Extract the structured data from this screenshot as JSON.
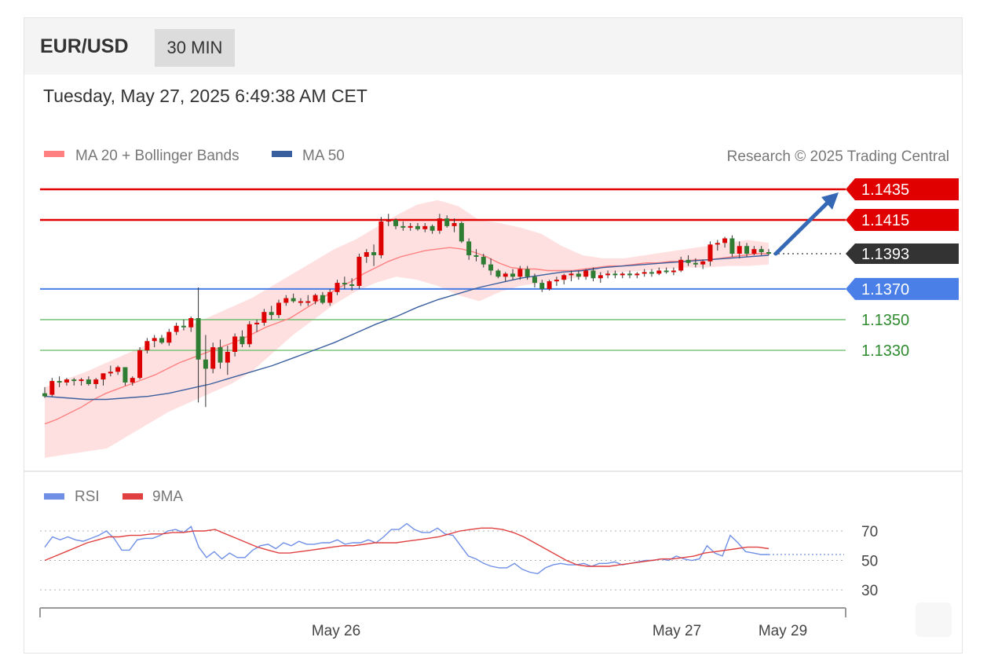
{
  "header": {
    "symbol": "EUR/USD",
    "timeframe": "30 MIN"
  },
  "timestamp": "Tuesday, May 27, 2025 6:49:38 AM CET",
  "legend": {
    "ma20_bb": "MA 20 + Bollinger Bands",
    "ma50": "MA 50"
  },
  "copyright": "Research © 2025 Trading Central",
  "rsi_legend": {
    "rsi": "RSI",
    "ma9": "9MA"
  },
  "colors": {
    "up": "#dd0000",
    "down": "#2e7d32",
    "ma20": "#ff8080",
    "ma50": "#3a5f9e",
    "bands": "#ffd6d6",
    "rsi": "#6f8fe6",
    "rsi_ma": "#e04040",
    "resistance": "#e00000",
    "support": "#4a7fe8",
    "support2": "#66bb66",
    "last": "#333333",
    "target_arrow": "#3568b5"
  },
  "chart_data": [
    {
      "type": "candlestick",
      "title": "EUR/USD",
      "timeframe": "30 MIN",
      "ylim": [
        1.1268,
        1.1448
      ],
      "x_ticks": [
        "May 26",
        "May 27",
        "May 29"
      ],
      "ohlc": [
        [
          1.1302,
          1.1306,
          1.1299,
          1.13
        ],
        [
          1.1301,
          1.1312,
          1.13,
          1.131
        ],
        [
          1.131,
          1.1313,
          1.1306,
          1.1309
        ],
        [
          1.1309,
          1.1312,
          1.1307,
          1.1311
        ],
        [
          1.1311,
          1.1312,
          1.1307,
          1.131
        ],
        [
          1.131,
          1.1312,
          1.1307,
          1.1311
        ],
        [
          1.1311,
          1.1313,
          1.1307,
          1.1308
        ],
        [
          1.1308,
          1.1312,
          1.1305,
          1.1311
        ],
        [
          1.1311,
          1.1315,
          1.1307,
          1.1315
        ],
        [
          1.1315,
          1.132,
          1.1313,
          1.1316
        ],
        [
          1.1316,
          1.132,
          1.1314,
          1.1319
        ],
        [
          1.1319,
          1.1319,
          1.1307,
          1.1309
        ],
        [
          1.1309,
          1.1313,
          1.1307,
          1.1312
        ],
        [
          1.1312,
          1.1332,
          1.1311,
          1.133
        ],
        [
          1.133,
          1.1338,
          1.1328,
          1.1336
        ],
        [
          1.1336,
          1.134,
          1.1332,
          1.1338
        ],
        [
          1.1338,
          1.134,
          1.1334,
          1.1335
        ],
        [
          1.1335,
          1.1344,
          1.1333,
          1.1342
        ],
        [
          1.1342,
          1.1348,
          1.134,
          1.1346
        ],
        [
          1.1346,
          1.135,
          1.1343,
          1.1345
        ],
        [
          1.1345,
          1.1352,
          1.1342,
          1.1351
        ],
        [
          1.1351,
          1.1371,
          1.1296,
          1.1324
        ],
        [
          1.1324,
          1.134,
          1.1293,
          1.1318
        ],
        [
          1.1318,
          1.1335,
          1.1315,
          1.1332
        ],
        [
          1.1332,
          1.1337,
          1.1318,
          1.1322
        ],
        [
          1.1322,
          1.1333,
          1.1314,
          1.1329
        ],
        [
          1.1329,
          1.1341,
          1.1326,
          1.1339
        ],
        [
          1.1339,
          1.1343,
          1.1332,
          1.1334
        ],
        [
          1.1334,
          1.1349,
          1.1332,
          1.1347
        ],
        [
          1.1347,
          1.135,
          1.1342,
          1.1348
        ],
        [
          1.1348,
          1.1357,
          1.1346,
          1.1355
        ],
        [
          1.1355,
          1.1359,
          1.135,
          1.1353
        ],
        [
          1.1353,
          1.1363,
          1.1351,
          1.1361
        ],
        [
          1.1361,
          1.1366,
          1.1359,
          1.1364
        ],
        [
          1.1364,
          1.1367,
          1.1361,
          1.1362
        ],
        [
          1.1362,
          1.1364,
          1.1359,
          1.1362
        ],
        [
          1.1362,
          1.1366,
          1.1359,
          1.1362
        ],
        [
          1.1362,
          1.1367,
          1.136,
          1.1366
        ],
        [
          1.1366,
          1.1368,
          1.136,
          1.1361
        ],
        [
          1.1361,
          1.137,
          1.1359,
          1.1368
        ],
        [
          1.1368,
          1.1376,
          1.1366,
          1.1374
        ],
        [
          1.1374,
          1.1378,
          1.137,
          1.1373
        ],
        [
          1.1373,
          1.1377,
          1.1369,
          1.1372
        ],
        [
          1.1372,
          1.1393,
          1.137,
          1.1391
        ],
        [
          1.1391,
          1.1396,
          1.1387,
          1.1394
        ],
        [
          1.1394,
          1.1399,
          1.1385,
          1.1392
        ],
        [
          1.1392,
          1.1417,
          1.139,
          1.1414
        ],
        [
          1.1414,
          1.1419,
          1.1411,
          1.1415
        ],
        [
          1.1415,
          1.1416,
          1.1409,
          1.1411
        ],
        [
          1.1411,
          1.1414,
          1.1408,
          1.141
        ],
        [
          1.141,
          1.1413,
          1.1408,
          1.1411
        ],
        [
          1.1411,
          1.1413,
          1.1408,
          1.1409
        ],
        [
          1.1409,
          1.1413,
          1.1407,
          1.1411
        ],
        [
          1.1411,
          1.1412,
          1.1406,
          1.1408
        ],
        [
          1.1408,
          1.1419,
          1.1406,
          1.1416
        ],
        [
          1.1416,
          1.1418,
          1.141,
          1.1411
        ],
        [
          1.1411,
          1.1416,
          1.1407,
          1.1413
        ],
        [
          1.1413,
          1.1414,
          1.14,
          1.1401
        ],
        [
          1.1401,
          1.1403,
          1.1389,
          1.1392
        ],
        [
          1.1392,
          1.1396,
          1.1388,
          1.1391
        ],
        [
          1.1391,
          1.1393,
          1.1384,
          1.1386
        ],
        [
          1.1386,
          1.139,
          1.1379,
          1.1382
        ],
        [
          1.1382,
          1.1383,
          1.1377,
          1.1378
        ],
        [
          1.1378,
          1.1381,
          1.1375,
          1.138
        ],
        [
          1.138,
          1.1383,
          1.1376,
          1.1378
        ],
        [
          1.1378,
          1.1385,
          1.1376,
          1.1383
        ],
        [
          1.1383,
          1.1385,
          1.1376,
          1.1378
        ],
        [
          1.1378,
          1.138,
          1.1371,
          1.1374
        ],
        [
          1.1374,
          1.1376,
          1.1368,
          1.137
        ],
        [
          1.137,
          1.1376,
          1.1369,
          1.1375
        ],
        [
          1.1375,
          1.1378,
          1.1372,
          1.1376
        ],
        [
          1.1376,
          1.138,
          1.1373,
          1.1379
        ],
        [
          1.1379,
          1.1382,
          1.1375,
          1.138
        ],
        [
          1.138,
          1.1382,
          1.1376,
          1.1378
        ],
        [
          1.1378,
          1.1383,
          1.1376,
          1.1382
        ],
        [
          1.1382,
          1.1384,
          1.1375,
          1.1377
        ],
        [
          1.1377,
          1.1381,
          1.1374,
          1.1379
        ],
        [
          1.1379,
          1.1382,
          1.1377,
          1.138
        ],
        [
          1.138,
          1.1382,
          1.1377,
          1.1379
        ],
        [
          1.1379,
          1.1381,
          1.1377,
          1.138
        ],
        [
          1.138,
          1.1382,
          1.1377,
          1.1379
        ],
        [
          1.1379,
          1.1381,
          1.1377,
          1.138
        ],
        [
          1.138,
          1.1383,
          1.1378,
          1.1381
        ],
        [
          1.1381,
          1.1383,
          1.1378,
          1.138
        ],
        [
          1.138,
          1.1384,
          1.1379,
          1.1382
        ],
        [
          1.1382,
          1.1384,
          1.138,
          1.1381
        ],
        [
          1.1381,
          1.1384,
          1.1379,
          1.1382
        ],
        [
          1.1382,
          1.1391,
          1.1381,
          1.1389
        ],
        [
          1.1389,
          1.1392,
          1.1385,
          1.1387
        ],
        [
          1.1387,
          1.139,
          1.1384,
          1.1386
        ],
        [
          1.1386,
          1.1389,
          1.1383,
          1.1388
        ],
        [
          1.1388,
          1.1401,
          1.1385,
          1.1399
        ],
        [
          1.1399,
          1.1402,
          1.1395,
          1.14
        ],
        [
          1.14,
          1.1404,
          1.1397,
          1.1403
        ],
        [
          1.1403,
          1.1405,
          1.1391,
          1.1393
        ],
        [
          1.1393,
          1.1401,
          1.139,
          1.1398
        ],
        [
          1.1398,
          1.14,
          1.1391,
          1.1393
        ],
        [
          1.1393,
          1.1398,
          1.1392,
          1.1396
        ],
        [
          1.1396,
          1.1398,
          1.1392,
          1.1394
        ],
        [
          1.1394,
          1.1396,
          1.1392,
          1.1393
        ]
      ],
      "ma20": [
        1.1282,
        1.1285,
        1.1289,
        1.1293,
        1.1298,
        1.1302,
        1.1305,
        1.1308,
        1.1311,
        1.1314,
        1.1318,
        1.1322,
        1.1325,
        1.1328,
        1.1331,
        1.1334,
        1.1337,
        1.1341,
        1.1345,
        1.1348,
        1.1351,
        1.1356,
        1.1361,
        1.1366,
        1.1371,
        1.1375,
        1.138,
        1.1384,
        1.1388,
        1.1391,
        1.1393,
        1.1395,
        1.1396,
        1.1397,
        1.1396,
        1.1394,
        1.1391,
        1.1387,
        1.1384,
        1.1383,
        1.1383,
        1.1382,
        1.1382,
        1.1382,
        1.1383,
        1.1384,
        1.1385,
        1.1385,
        1.1386,
        1.1387,
        1.1387,
        1.1388,
        1.1388,
        1.1389,
        1.1389,
        1.139,
        1.1391,
        1.1392,
        1.1393,
        1.1393
      ],
      "ma50": [
        1.13,
        1.1299,
        1.1298,
        1.1298,
        1.1299,
        1.13,
        1.1302,
        1.1305,
        1.1308,
        1.1312,
        1.1316,
        1.132,
        1.1325,
        1.133,
        1.1335,
        1.1341,
        1.1347,
        1.1352,
        1.1358,
        1.1363,
        1.1367,
        1.1371,
        1.1374,
        1.1377,
        1.1379,
        1.1381,
        1.1382,
        1.1384,
        1.1385,
        1.1386,
        1.1387,
        1.1388,
        1.1389,
        1.139,
        1.1391,
        1.1392
      ],
      "bb_upper": [
        1.1306,
        1.1311,
        1.1316,
        1.1322,
        1.1328,
        1.1334,
        1.134,
        1.1346,
        1.1352,
        1.1358,
        1.1364,
        1.1372,
        1.138,
        1.1388,
        1.1396,
        1.1402,
        1.141,
        1.1418,
        1.1425,
        1.1428,
        1.1424,
        1.1415,
        1.1413,
        1.141,
        1.1406,
        1.1398,
        1.1392,
        1.139,
        1.139,
        1.1392,
        1.1394,
        1.1396,
        1.1398,
        1.14,
        1.1402,
        1.14
      ],
      "bb_lower": [
        1.126,
        1.1262,
        1.1264,
        1.1266,
        1.1274,
        1.1282,
        1.129,
        1.1296,
        1.1302,
        1.1308,
        1.1316,
        1.1328,
        1.134,
        1.135,
        1.136,
        1.1368,
        1.1374,
        1.1378,
        1.1376,
        1.1372,
        1.1366,
        1.1362,
        1.1368,
        1.1372,
        1.1374,
        1.1376,
        1.1378,
        1.138,
        1.1381,
        1.1382,
        1.1383,
        1.1384,
        1.1384,
        1.1385,
        1.1385,
        1.1386
      ],
      "levels": [
        {
          "value": "1.1435",
          "price": 1.1435,
          "role": "resistance"
        },
        {
          "value": "1.1415",
          "price": 1.1415,
          "role": "resistance"
        },
        {
          "value": "1.1393",
          "price": 1.1393,
          "role": "last"
        },
        {
          "value": "1.1370",
          "price": 1.137,
          "role": "support"
        },
        {
          "value": "1.1350",
          "price": 1.135,
          "role": "support2"
        },
        {
          "value": "1.1330",
          "price": 1.133,
          "role": "support2"
        }
      ],
      "arrow": {
        "from": 1.1393,
        "to": 1.1435
      }
    },
    {
      "type": "line",
      "title": "RSI",
      "ylim": [
        22,
        78
      ],
      "yticks": [
        "70",
        "50",
        "30"
      ],
      "series": [
        {
          "name": "RSI",
          "values": [
            59,
            66,
            64,
            66,
            64,
            63,
            65,
            67,
            70,
            65,
            57,
            57,
            64,
            65,
            65,
            67,
            70,
            71,
            69,
            73,
            59,
            52,
            56,
            51,
            55,
            52,
            52,
            57,
            60,
            61,
            58,
            62,
            60,
            63,
            61,
            61,
            62,
            62,
            64,
            61,
            62,
            62,
            64,
            62,
            66,
            71,
            71,
            75,
            71,
            69,
            69,
            72,
            68,
            67,
            60,
            53,
            51,
            48,
            46,
            45,
            45,
            48,
            44,
            42,
            41,
            45,
            47,
            48,
            47,
            47,
            48,
            46,
            48,
            48,
            49,
            47,
            48,
            49,
            50,
            50,
            51,
            50,
            53,
            51,
            50,
            51,
            60,
            55,
            53,
            67,
            62,
            56,
            55,
            54,
            54
          ]
        },
        {
          "name": "9MA",
          "values": [
            50,
            53,
            56,
            59,
            62,
            64,
            66,
            66,
            67,
            67,
            68,
            68,
            69,
            69,
            70,
            70,
            71,
            68,
            65,
            62,
            59,
            57,
            55,
            55,
            56,
            57,
            58,
            59,
            60,
            60,
            61,
            62,
            62,
            62,
            63,
            64,
            65,
            66,
            68,
            70,
            71,
            72,
            72,
            71,
            69,
            66,
            62,
            58,
            54,
            50,
            47,
            46,
            46,
            46,
            47,
            48,
            49,
            50,
            51,
            51,
            52,
            53,
            55,
            56,
            57,
            58,
            59,
            59,
            58
          ]
        }
      ]
    }
  ]
}
